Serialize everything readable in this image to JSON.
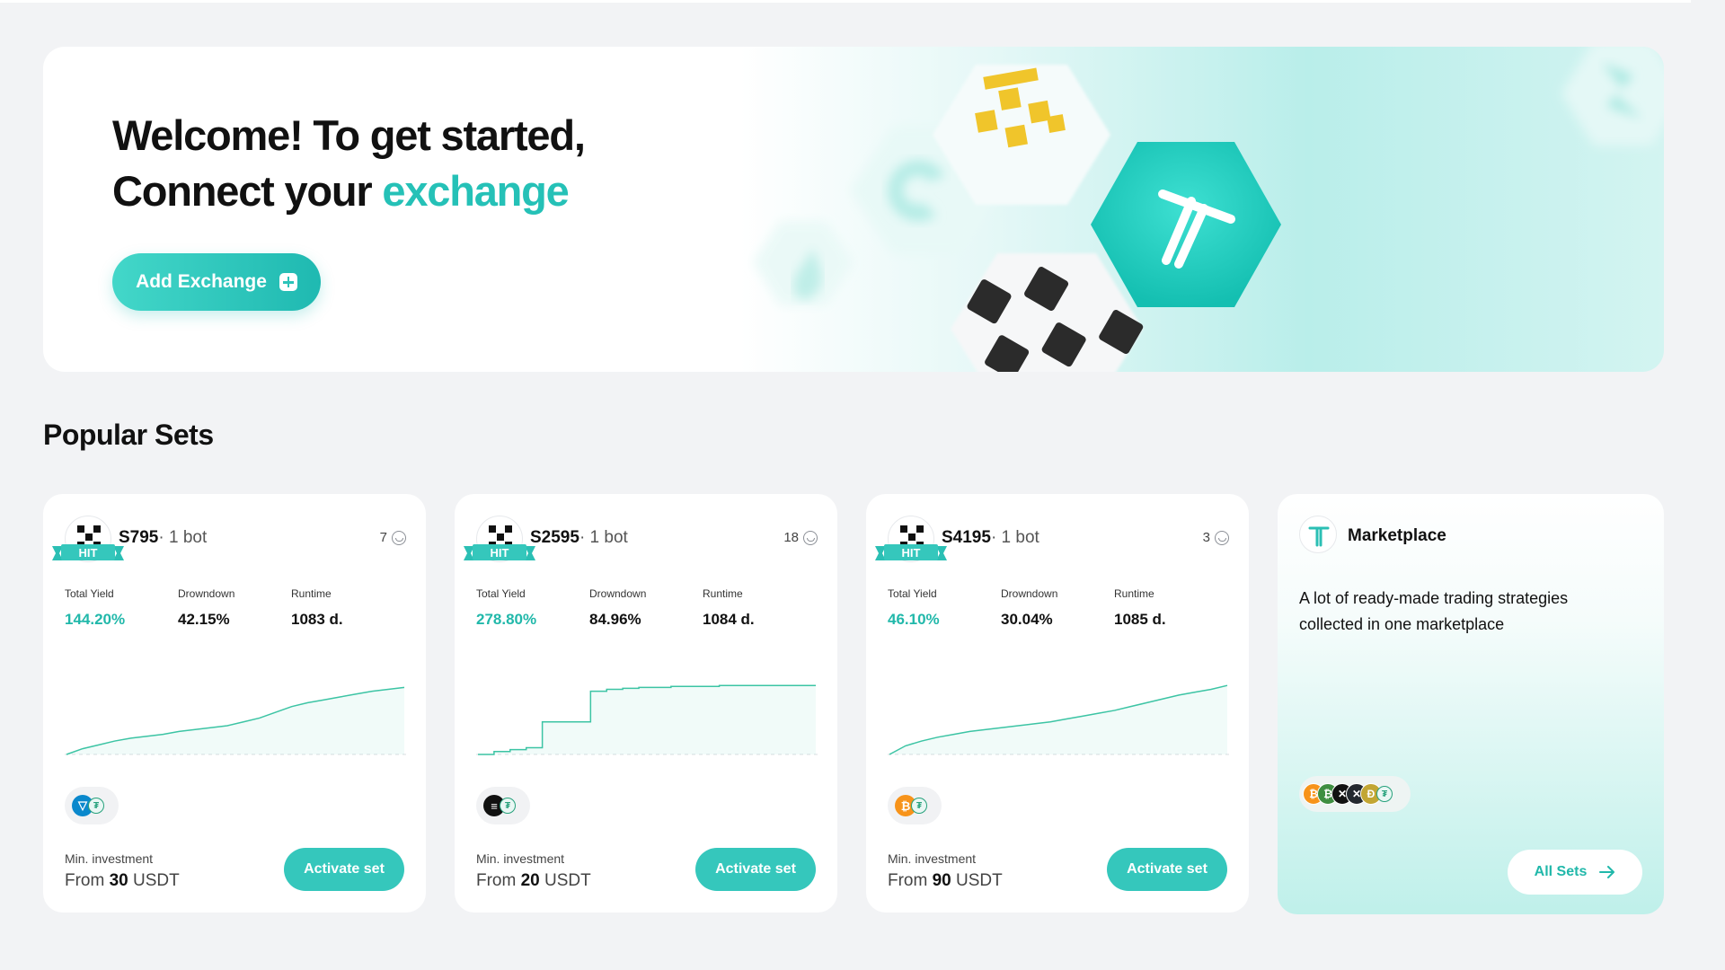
{
  "hero": {
    "title_line1": "Welcome! To get started,",
    "title_line2_prefix": "Connect your ",
    "title_line2_accent": "exchange",
    "add_exchange_label": "Add Exchange"
  },
  "popular_sets": {
    "title": "Popular Sets",
    "stat_labels": {
      "yield": "Total Yield",
      "drawdown": "Drowndown",
      "runtime": "Runtime"
    },
    "min_label": "Min. investment",
    "activate_label": "Activate set",
    "hit_label": "HIT",
    "cards": [
      {
        "name": "S795",
        "bots": "· 1 bot",
        "users": "7",
        "yield": "144.20%",
        "drawdown": "42.15%",
        "runtime": "1083 d.",
        "min_prefix": "From ",
        "min_amount": "30",
        "min_unit": " USDT",
        "coin": "TON",
        "curve": [
          0,
          6,
          10,
          14,
          17,
          19,
          21,
          24,
          26,
          28,
          30,
          34,
          38,
          44,
          50,
          54,
          57,
          60,
          63,
          66,
          68,
          70
        ]
      },
      {
        "name": "S2595",
        "bots": "· 1 bot",
        "users": "18",
        "yield": "278.80%",
        "drawdown": "84.96%",
        "runtime": "1084 d.",
        "min_prefix": "From ",
        "min_amount": "20",
        "min_unit": " USDT",
        "coin": "SOL",
        "curve": [
          0,
          3,
          5,
          7,
          34,
          34,
          34,
          66,
          68,
          69,
          70,
          70,
          71,
          71,
          71,
          72,
          72,
          72,
          72,
          72,
          72,
          72
        ]
      },
      {
        "name": "S4195",
        "bots": "· 1 bot",
        "users": "3",
        "yield": "46.10%",
        "drawdown": "30.04%",
        "runtime": "1085 d.",
        "min_prefix": "From ",
        "min_amount": "90",
        "min_unit": " USDT",
        "coin": "BTC",
        "curve": [
          0,
          9,
          14,
          18,
          21,
          24,
          26,
          28,
          30,
          32,
          34,
          37,
          40,
          43,
          46,
          50,
          54,
          58,
          62,
          65,
          68,
          72
        ]
      }
    ]
  },
  "marketplace": {
    "title": "Marketplace",
    "description": "A lot of ready-made trading strategies collected in one marketplace",
    "all_sets_label": "All Sets",
    "coins": [
      "BTC",
      "BCH",
      "XLM",
      "XRP",
      "DOGE",
      "USDT"
    ]
  },
  "colors": {
    "accent": "#25c1b7",
    "button": "#35c7bc",
    "green_value": "#21b8aa",
    "curve": "#3cc4a4"
  },
  "icons": [
    "plus-square-icon",
    "okx-logo-icon",
    "hit-ribbon-icon",
    "users-smile-icon",
    "arrow-right-icon",
    "tradesanta-logo-icon"
  ]
}
